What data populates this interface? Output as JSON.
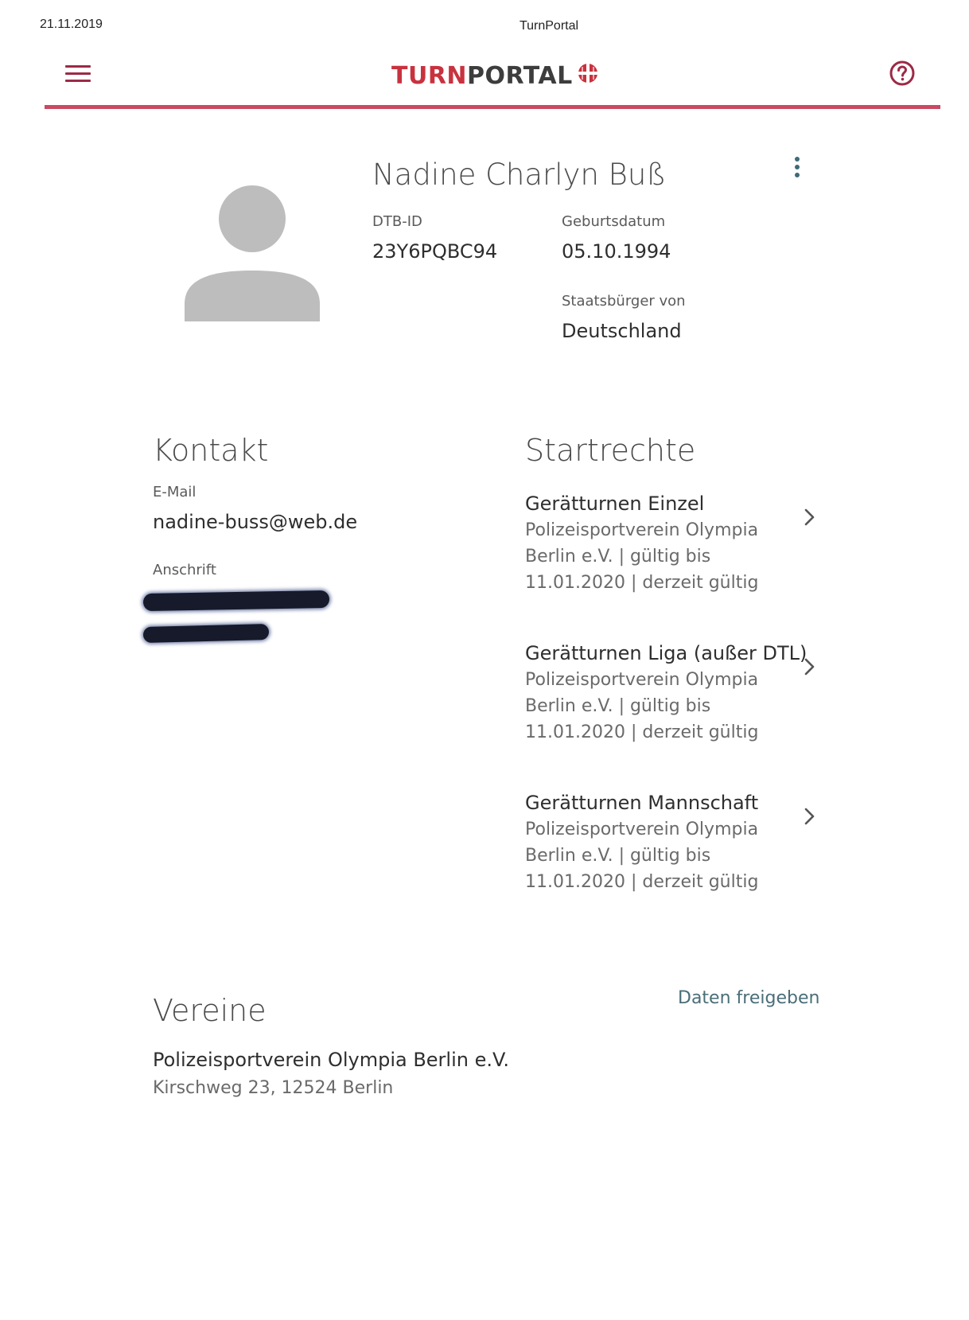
{
  "print_header": {
    "date": "21.11.2019",
    "title": "TurnPortal"
  },
  "appbar": {
    "logo_part1": "TURN",
    "logo_part2": "PORTAL",
    "menu_icon": "hamburger-menu-icon",
    "help_icon": "help-circle-icon",
    "accent_color": "#c94a63"
  },
  "profile": {
    "name": "Nadine Charlyn Buß",
    "dtb_id_label": "DTB-ID",
    "dtb_id": "23Y6PQBC94",
    "birthdate_label": "Geburtsdatum",
    "birthdate": "05.10.1994",
    "citizenship_label": "Staatsbürger von",
    "citizenship": "Deutschland"
  },
  "kontakt": {
    "title": "Kontakt",
    "email_label": "E-Mail",
    "email": "nadine-buss@web.de",
    "address_label": "Anschrift"
  },
  "startrechte": {
    "title": "Startrechte",
    "items": [
      {
        "title": "Gerätturnen Einzel",
        "description": "Polizeisportverein Olympia Berlin e.V. | gültig bis 11.01.2020 | derzeit gültig"
      },
      {
        "title": "Gerätturnen Liga (außer DTL)",
        "description": "Polizeisportverein Olympia Berlin e.V. | gültig bis 11.01.2020 | derzeit gültig"
      },
      {
        "title": "Gerätturnen Mannschaft",
        "description": "Polizeisportverein Olympia Berlin e.V. | gültig bis 11.01.2020 | derzeit gültig"
      }
    ]
  },
  "vereine": {
    "title": "Vereine",
    "share_link": "Daten freigeben",
    "items": [
      {
        "name": "Polizeisportverein Olympia Berlin e.V.",
        "address": "Kirschweg 23, 12524 Berlin"
      }
    ]
  }
}
